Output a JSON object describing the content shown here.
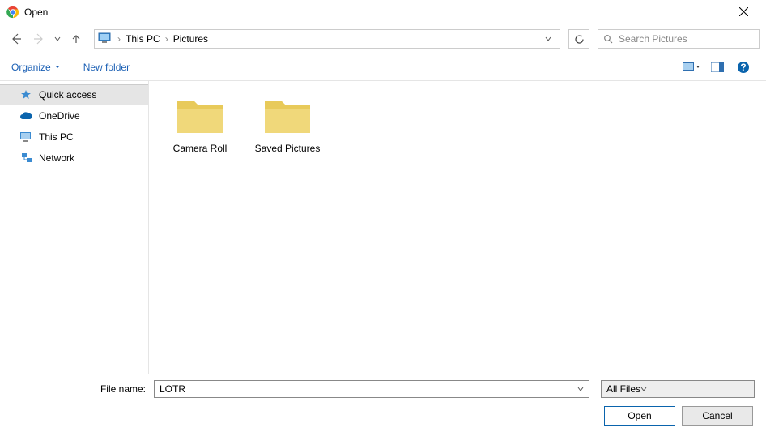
{
  "title": "Open",
  "breadcrumb": {
    "root": "This PC",
    "folder": "Pictures"
  },
  "search": {
    "placeholder": "Search Pictures"
  },
  "toolbar": {
    "organize": "Organize",
    "new_folder": "New folder"
  },
  "sidebar": {
    "items": [
      {
        "label": "Quick access"
      },
      {
        "label": "OneDrive"
      },
      {
        "label": "This PC"
      },
      {
        "label": "Network"
      }
    ]
  },
  "content": {
    "folders": [
      {
        "label": "Camera Roll"
      },
      {
        "label": "Saved Pictures"
      }
    ]
  },
  "footer": {
    "filename_label": "File name:",
    "filename_value": "LOTR",
    "filter": "All Files",
    "open": "Open",
    "cancel": "Cancel"
  }
}
